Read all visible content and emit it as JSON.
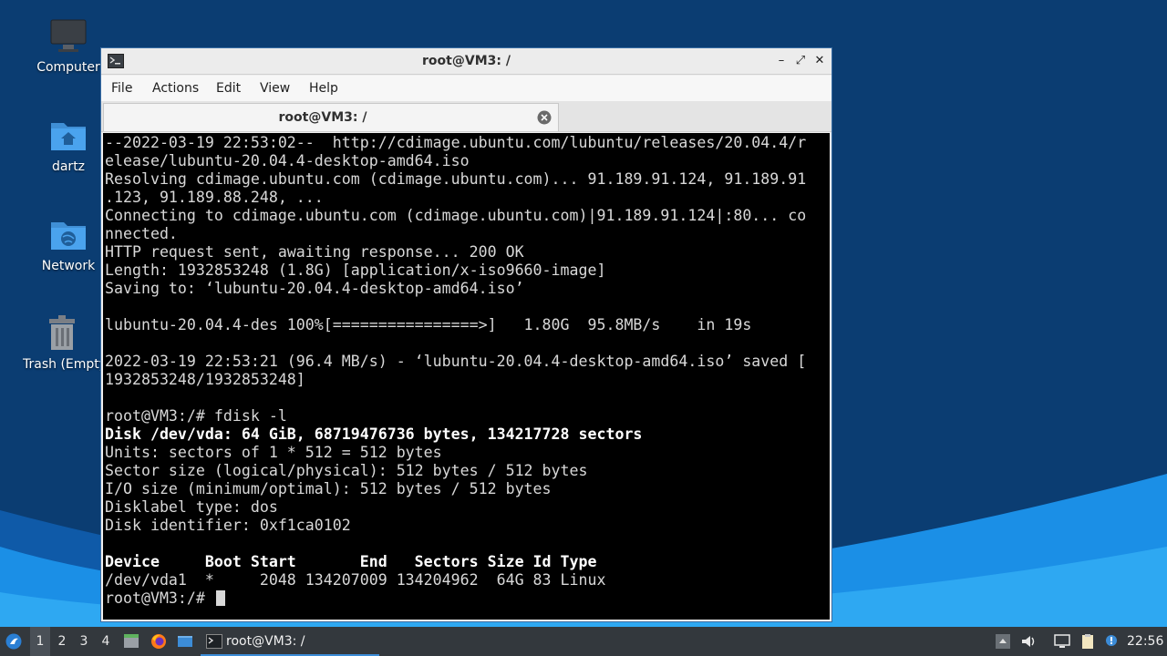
{
  "desktop": {
    "icons": [
      {
        "label": "Computer"
      },
      {
        "label": "dartz"
      },
      {
        "label": "Network"
      },
      {
        "label": "Trash (Empty)"
      }
    ]
  },
  "window": {
    "title": "root@VM3: /",
    "menu": [
      "File",
      "Actions",
      "Edit",
      "View",
      "Help"
    ],
    "tab_label": "root@VM3: /"
  },
  "terminal": {
    "lines": [
      "--2022-03-19 22:53:02--  http://cdimage.ubuntu.com/lubuntu/releases/20.04.4/r",
      "elease/lubuntu-20.04.4-desktop-amd64.iso",
      "Resolving cdimage.ubuntu.com (cdimage.ubuntu.com)... 91.189.91.124, 91.189.91",
      ".123, 91.189.88.248, ...",
      "Connecting to cdimage.ubuntu.com (cdimage.ubuntu.com)|91.189.91.124|:80... co",
      "nnected.",
      "HTTP request sent, awaiting response... 200 OK",
      "Length: 1932853248 (1.8G) [application/x-iso9660-image]",
      "Saving to: ‘lubuntu-20.04.4-desktop-amd64.iso’",
      "",
      "lubuntu-20.04.4-des 100%[================>]   1.80G  95.8MB/s    in 19s",
      "",
      "2022-03-19 22:53:21 (96.4 MB/s) - ‘lubuntu-20.04.4-desktop-amd64.iso’ saved [",
      "1932853248/1932853248]",
      "",
      "root@VM3:/# fdisk -l",
      "Disk /dev/vda: 64 GiB, 68719476736 bytes, 134217728 sectors",
      "Units: sectors of 1 * 512 = 512 bytes",
      "Sector size (logical/physical): 512 bytes / 512 bytes",
      "I/O size (minimum/optimal): 512 bytes / 512 bytes",
      "Disklabel type: dos",
      "Disk identifier: 0xf1ca0102",
      "",
      "Device     Boot Start       End   Sectors Size Id Type",
      "/dev/vda1  *     2048 134207009 134204962  64G 83 Linux",
      "root@VM3:/# "
    ]
  },
  "taskbar": {
    "workspaces": [
      "1",
      "2",
      "3",
      "4"
    ],
    "task_label": "root@VM3: /",
    "clock": "22:56"
  },
  "colors": {
    "desktop_bg": "#0a3a6e",
    "wave_light": "#1b8fe6",
    "terminal_bg": "#000000",
    "terminal_fg": "#d8d8d8",
    "taskbar_bg": "#33383d",
    "accent": "#3c8cd7"
  }
}
